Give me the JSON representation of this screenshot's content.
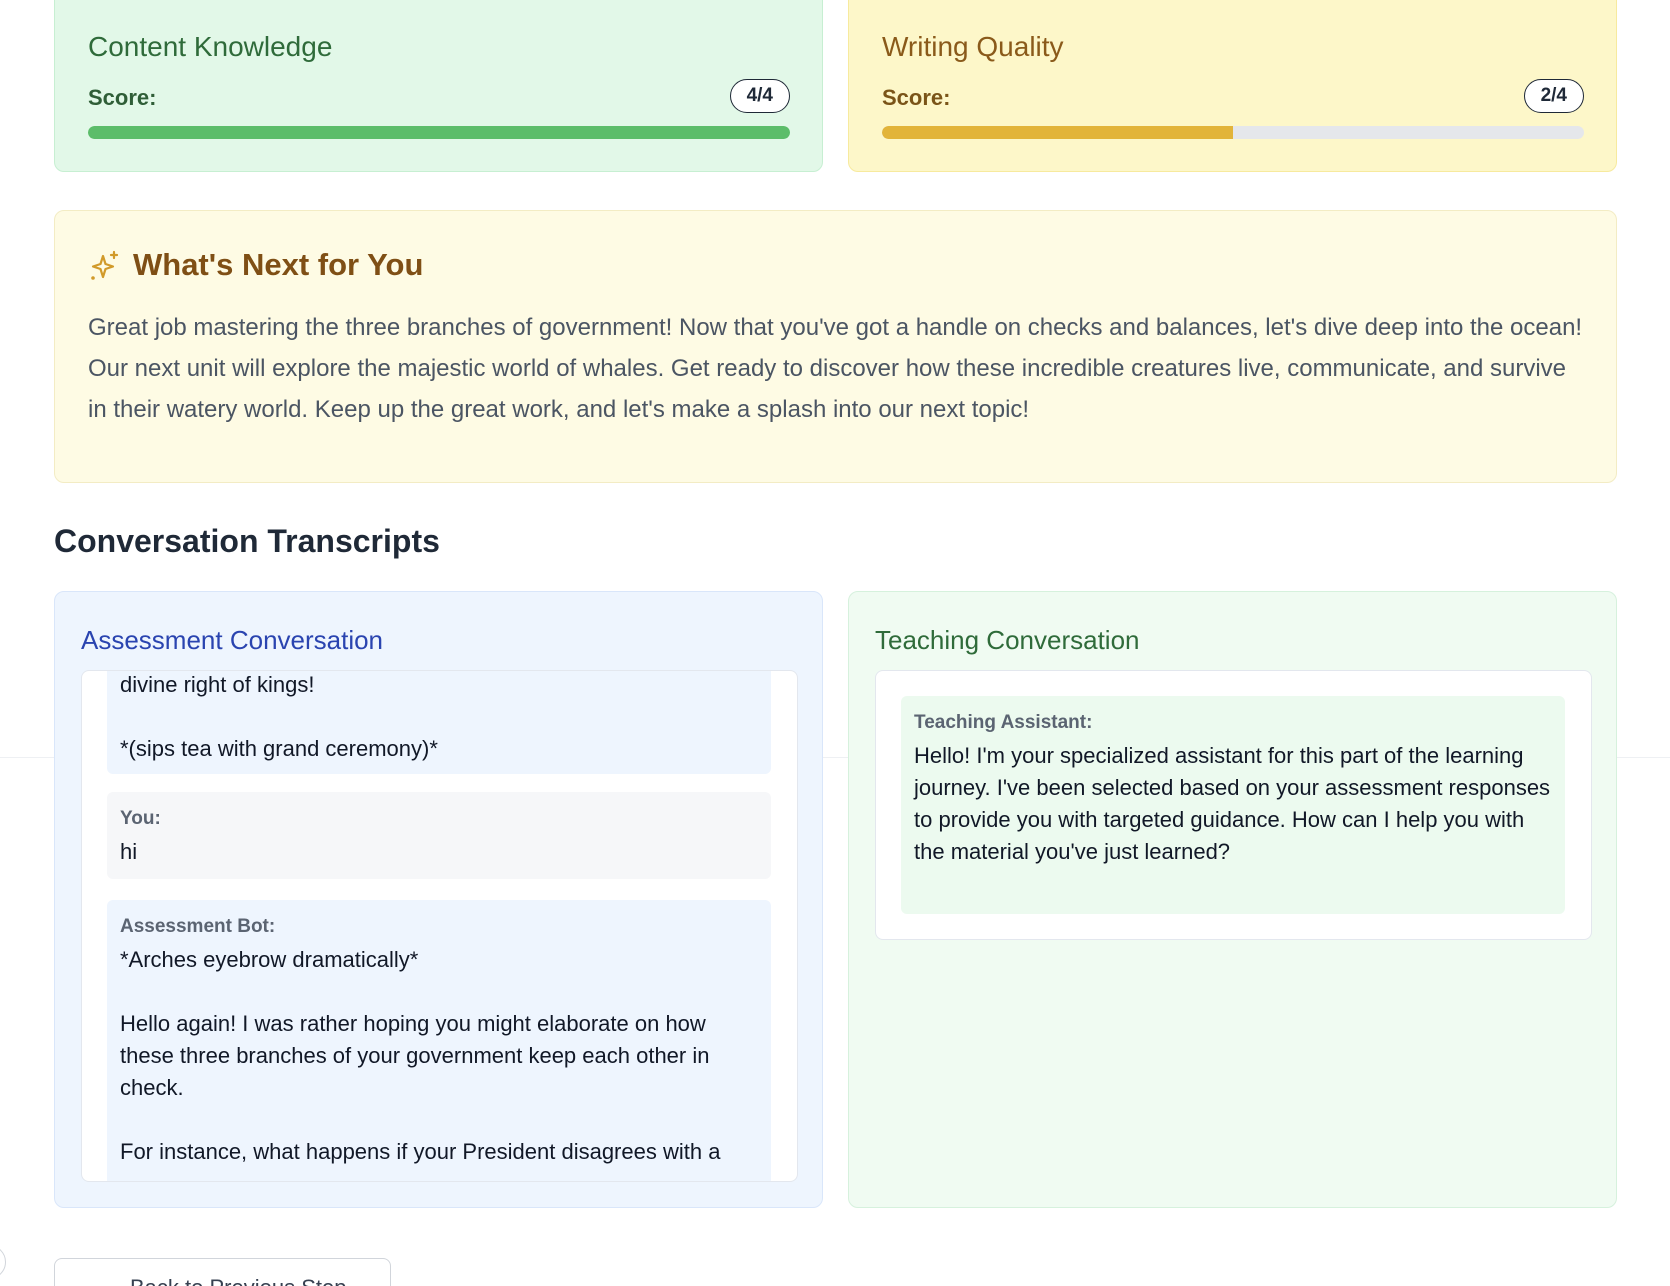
{
  "scores": [
    {
      "title": "Content Knowledge",
      "label": "Score:",
      "badge": "4/4",
      "fraction": 1.0
    },
    {
      "title": "Writing Quality",
      "label": "Score:",
      "badge": "2/4",
      "fraction": 0.5
    }
  ],
  "next": {
    "icon": "sparkles-icon",
    "title": "What's Next for You",
    "body": "Great job mastering the three branches of government! Now that you've got a handle on checks and balances, let's dive deep into the ocean! Our next unit will explore the majestic world of whales. Get ready to discover how these incredible creatures live, communicate, and survive in their watery world. Keep up the great work, and let's make a splash into our next topic!"
  },
  "transcripts": {
    "title": "Conversation Transcripts",
    "assessment": {
      "title": "Assessment Conversation",
      "messages": [
        {
          "author": "",
          "text": "divine right of kings!\n\n*(sips tea with grand ceremony)*"
        },
        {
          "author": "You:",
          "text": "hi"
        },
        {
          "author": "Assessment Bot:",
          "text": "*Arches eyebrow dramatically*\n\nHello again! I was rather hoping you might elaborate on how these three branches of your government keep each other in check.\n\nFor instance, what happens if your President disagrees with a"
        }
      ]
    },
    "teaching": {
      "title": "Teaching Conversation",
      "messages": [
        {
          "author": "Teaching Assistant:",
          "text": "Hello! I'm your specialized assistant for this part of the learning journey. I've been selected based on your assessment responses to provide you with targeted guidance. How can I help you with the material you've just learned?"
        }
      ]
    }
  },
  "back_button": {
    "icon": "arrow-left-icon",
    "label": "Back to Previous Step"
  },
  "colors": {
    "green_bar": "#5cbd6a",
    "yellow_bar": "#e2b43a",
    "next_title": "#7f4f15",
    "assessment_title": "#2a44b0"
  }
}
